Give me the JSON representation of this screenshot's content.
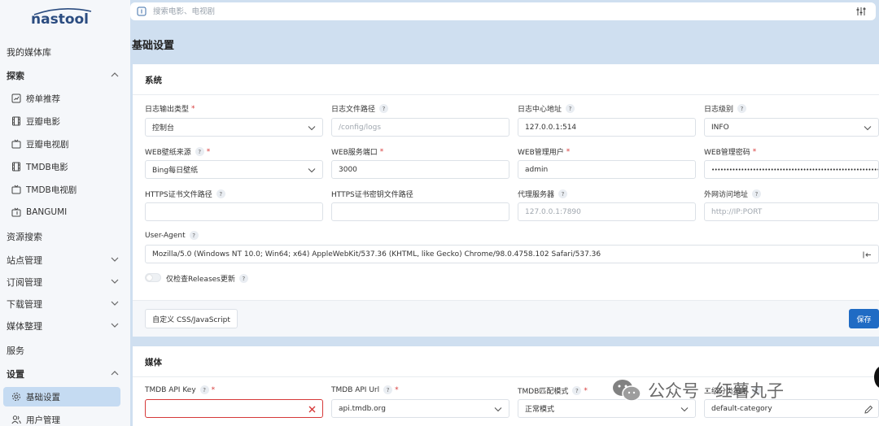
{
  "brand": {
    "name": "nastool"
  },
  "sidebar": {
    "items": [
      {
        "label": "我的媒体库"
      },
      {
        "label": "探索"
      },
      {
        "label": "榜单推荐"
      },
      {
        "label": "豆瓣电影"
      },
      {
        "label": "豆瓣电视剧"
      },
      {
        "label": "TMDB电影"
      },
      {
        "label": "TMDB电视剧"
      },
      {
        "label": "BANGUMI"
      },
      {
        "label": "资源搜索"
      },
      {
        "label": "站点管理"
      },
      {
        "label": "订阅管理"
      },
      {
        "label": "下载管理"
      },
      {
        "label": "媒体整理"
      },
      {
        "label": "服务"
      },
      {
        "label": "设置"
      },
      {
        "label": "基础设置"
      },
      {
        "label": "用户管理"
      }
    ]
  },
  "search": {
    "placeholder": "搜索电影、电视剧"
  },
  "page": {
    "title": "基础设置"
  },
  "system": {
    "title": "系统",
    "log_type": {
      "label": "日志输出类型",
      "value": "控制台"
    },
    "log_path": {
      "label": "日志文件路径",
      "placeholder": "/config/logs"
    },
    "log_server": {
      "label": "日志中心地址",
      "value": "127.0.0.1:514"
    },
    "log_level": {
      "label": "日志级别",
      "value": "INFO"
    },
    "wallpaper": {
      "label": "WEB壁纸来源",
      "value": "Bing每日壁纸"
    },
    "web_port": {
      "label": "WEB服务端口",
      "value": "3000"
    },
    "web_user": {
      "label": "WEB管理用户",
      "value": "admin"
    },
    "web_password": {
      "label": "WEB管理密码",
      "value": "••••••••••••••••••••••••••••••••••••••••••••••••••••••••••••••••"
    },
    "ssl_cert": {
      "label": "HTTPS证书文件路径",
      "value": ""
    },
    "ssl_key": {
      "label": "HTTPS证书密钥文件路径",
      "value": ""
    },
    "proxy": {
      "label": "代理服务器",
      "placeholder": "127.0.0.1:7890"
    },
    "domain": {
      "label": "外网访问地址",
      "placeholder": "http://IP:PORT"
    },
    "user_agent": {
      "label": "User-Agent",
      "value": "Mozilla/5.0 (Windows NT 10.0; Win64; x64) AppleWebKit/537.36 (KHTML, like Gecko) Chrome/98.0.4758.102 Safari/537.36"
    },
    "releases_toggle": {
      "label": "仅检查Releases更新",
      "checked": false
    },
    "custom_css_button": "自定义 CSS/JavaScript",
    "save_button": "保存"
  },
  "media": {
    "title": "媒体",
    "tmdb_key": {
      "label": "TMDB API Key",
      "value": ""
    },
    "tmdb_url": {
      "label": "TMDB API Url",
      "value": "api.tmdb.org"
    },
    "tmdb_match": {
      "label": "TMDB匹配模式",
      "value": "正常模式"
    },
    "category": {
      "label": "二级分类策略",
      "value": "default-category"
    }
  },
  "watermark": {
    "text": "公众号 · 红薯丸子"
  },
  "colors": {
    "primary": "#206bc4",
    "error": "#d63939",
    "sidebar_active": "#c5dbf2",
    "background": "#cfdff0"
  }
}
